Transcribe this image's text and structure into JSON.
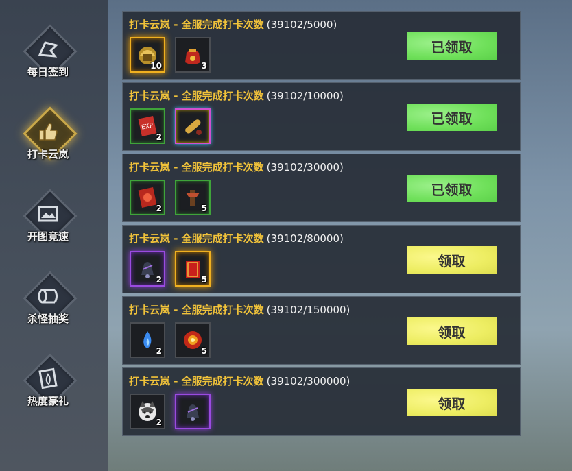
{
  "sidebar": {
    "items": [
      {
        "label": "每日签到",
        "icon": "flag-icon",
        "active": false
      },
      {
        "label": "打卡云岚",
        "icon": "thumbs-up-icon",
        "active": true
      },
      {
        "label": "开图竞速",
        "icon": "map-icon",
        "active": false
      },
      {
        "label": "杀怪抽奖",
        "icon": "scroll-icon",
        "active": false
      },
      {
        "label": "热度豪礼",
        "icon": "flame-card-icon",
        "active": false
      }
    ]
  },
  "tasks": [
    {
      "title": "打卡云岚 - 全服完成打卡次数",
      "progress": "(39102/5000)",
      "button": "已领取",
      "status": "claimed",
      "rewards": [
        {
          "icon": "golden-helmet-icon",
          "count": "10",
          "frame": "gold"
        },
        {
          "icon": "red-pouch-icon",
          "count": "3",
          "frame": "plain"
        }
      ]
    },
    {
      "title": "打卡云岚 - 全服完成打卡次数",
      "progress": "(39102/10000)",
      "button": "已领取",
      "status": "claimed",
      "rewards": [
        {
          "icon": "exp-scroll-icon",
          "count": "2",
          "frame": "green"
        },
        {
          "icon": "rolled-scroll-icon",
          "count": "",
          "frame": "rainbow"
        }
      ]
    },
    {
      "title": "打卡云岚 - 全服完成打卡次数",
      "progress": "(39102/30000)",
      "button": "已领取",
      "status": "claimed",
      "rewards": [
        {
          "icon": "red-scroll-icon",
          "count": "2",
          "frame": "green"
        },
        {
          "icon": "totem-icon",
          "count": "5",
          "frame": "green"
        }
      ]
    },
    {
      "title": "打卡云岚 - 全服完成打卡次数",
      "progress": "(39102/80000)",
      "button": "领取",
      "status": "available",
      "rewards": [
        {
          "icon": "bell-icon",
          "count": "2",
          "frame": "purple"
        },
        {
          "icon": "red-book-icon",
          "count": "5",
          "frame": "gold"
        }
      ]
    },
    {
      "title": "打卡云岚 - 全服完成打卡次数",
      "progress": "(39102/150000)",
      "button": "领取",
      "status": "available",
      "rewards": [
        {
          "icon": "blue-flame-icon",
          "count": "2",
          "frame": "plain"
        },
        {
          "icon": "fire-orb-icon",
          "count": "5",
          "frame": "plain"
        }
      ]
    },
    {
      "title": "打卡云岚 - 全服完成打卡次数",
      "progress": "(39102/300000)",
      "button": "领取",
      "status": "available",
      "rewards": [
        {
          "icon": "husky-pet-icon",
          "count": "2",
          "frame": "plain"
        },
        {
          "icon": "bell-icon",
          "count": "",
          "frame": "purple"
        }
      ]
    }
  ]
}
